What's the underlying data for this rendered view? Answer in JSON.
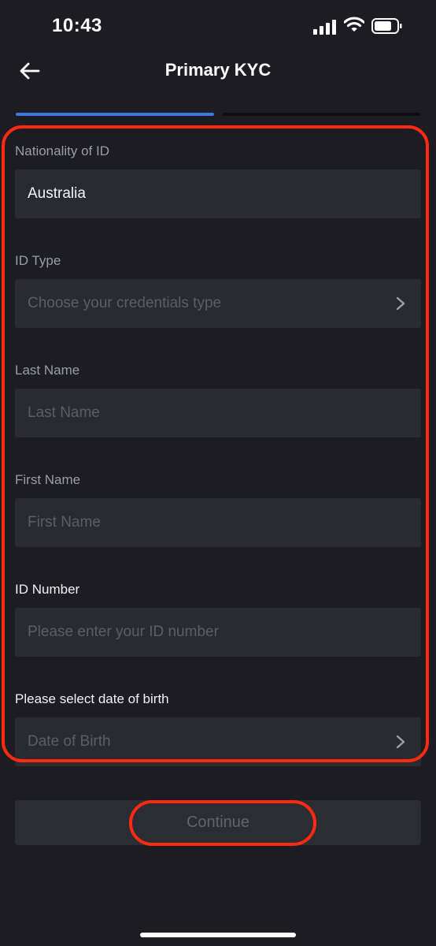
{
  "status_bar": {
    "time": "10:43",
    "signal_icon": "signal-icon",
    "wifi_icon": "wifi-icon",
    "battery_icon": "battery-icon"
  },
  "nav": {
    "title": "Primary KYC",
    "back_icon": "arrow-left-icon"
  },
  "progress": {
    "total_steps": 2,
    "current_step": 1,
    "active_color": "#3d79e2"
  },
  "form": {
    "nationality": {
      "label": "Nationality of ID",
      "value": "Australia"
    },
    "id_type": {
      "label": "ID Type",
      "placeholder": "Choose your credentials type"
    },
    "last_name": {
      "label": "Last Name",
      "placeholder": "Last Name"
    },
    "first_name": {
      "label": "First Name",
      "placeholder": "First Name"
    },
    "id_number": {
      "label": "ID Number",
      "placeholder": "Please enter your ID number"
    },
    "date_of_birth": {
      "label": "Please select date of birth",
      "placeholder": "Date of Birth"
    }
  },
  "continue_button": {
    "label": "Continue"
  },
  "colors": {
    "background": "#1c1c22",
    "field": "#2a2a31",
    "highlight": "#ff2a12"
  }
}
